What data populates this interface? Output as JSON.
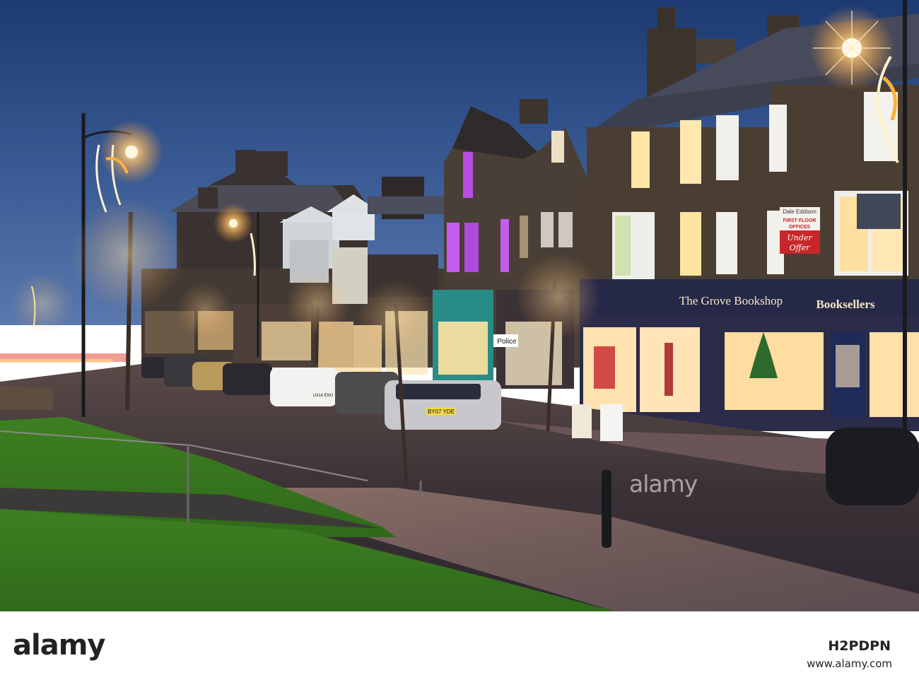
{
  "signs": {
    "bookshop": "The Grove Bookshop",
    "booksellers": "Booksellers",
    "police": "Police",
    "agent_line1": "Dale Eddison",
    "agent_line2": "FIRST FLOOR",
    "agent_line3": "OFFICES",
    "agent_under": "Under",
    "agent_offer": "Offer",
    "plate1": "BY07 YDE",
    "plate2": "LN14 EWJ"
  },
  "watermark": {
    "text": "alamy"
  },
  "footer": {
    "logo": "alamy",
    "image_id": "H2PDPN",
    "website": "www.alamy.com"
  },
  "colors": {
    "sky_top": "#1d3a72",
    "sky_bottom": "#4f6fa8",
    "stone": "#4a3e33",
    "window_glow": "#ffe6a6",
    "grass": "#4f8f2a",
    "sign_panel": "#262848"
  }
}
